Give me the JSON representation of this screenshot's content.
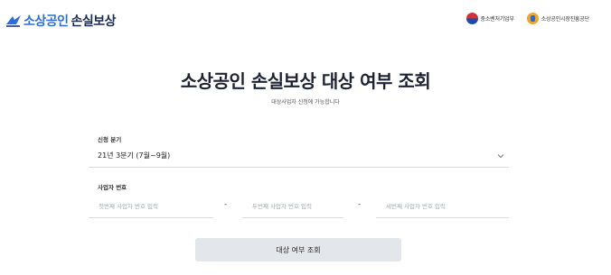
{
  "header": {
    "logo": {
      "part_a": "소상공인",
      "part_b": "손실보상"
    },
    "partners": [
      {
        "name": "중소벤처기업부",
        "icon": "mss-emblem-icon"
      },
      {
        "name": "소상공인시장진흥공단",
        "icon": "semas-emblem-icon"
      }
    ]
  },
  "main": {
    "title": "소상공인 손실보상 대상 여부 조회",
    "subtitle": "대상사업자 신청에 가능합니다"
  },
  "form": {
    "period": {
      "label": "신청 분기",
      "value": "21년 3분기 (7월~9월)"
    },
    "business_number": {
      "label": "사업자 번호",
      "separator": "-",
      "part1_placeholder": "첫번째 사업자 번호 입력",
      "part2_placeholder": "두번째 사업자 번호 입력",
      "part3_placeholder": "세번째 사업자 번호 입력"
    },
    "submit_label": "대상 여부 조회"
  },
  "colors": {
    "brand_blue": "#2b6fd6",
    "brand_navy": "#1a2a55",
    "button_bg": "#e3e6ea"
  }
}
